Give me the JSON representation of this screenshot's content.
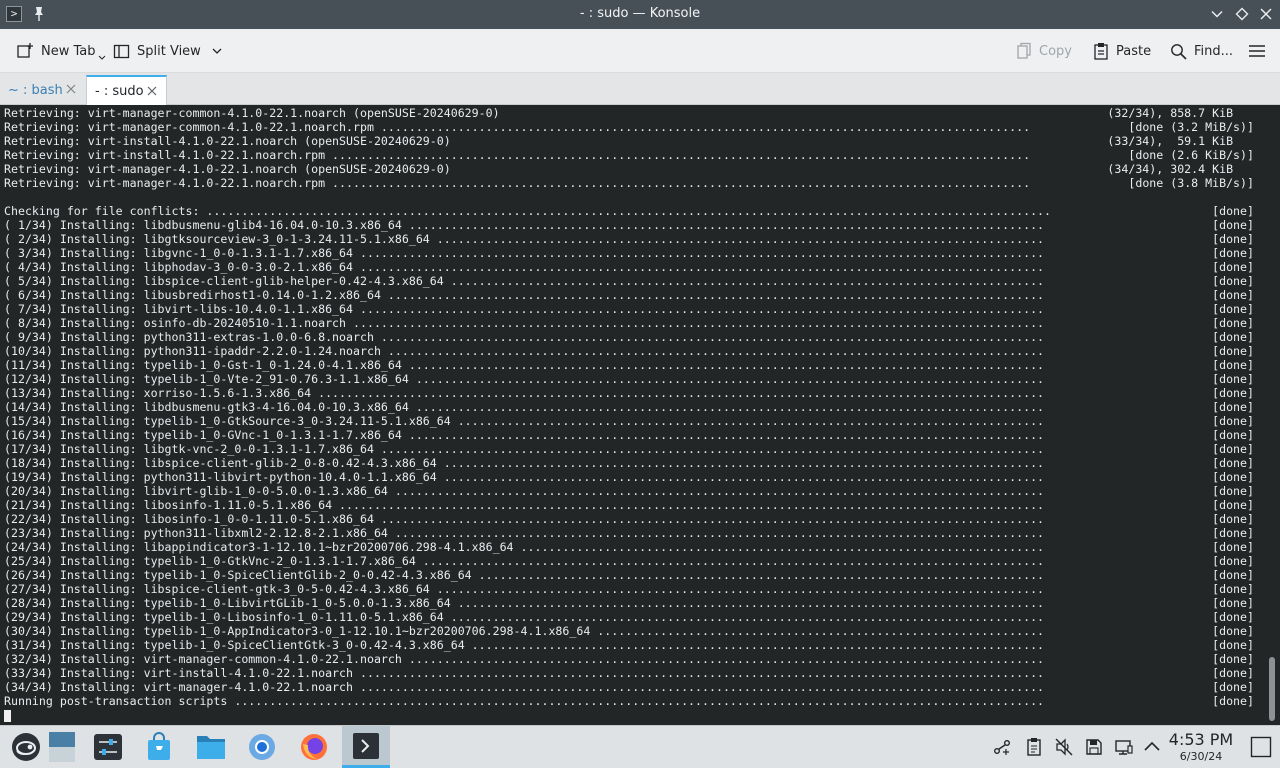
{
  "window": {
    "title": "- : sudo — Konsole"
  },
  "toolbar": {
    "new_tab_label": "New Tab",
    "split_view_label": "Split View",
    "copy_label": "Copy",
    "paste_label": "Paste",
    "find_label": "Find..."
  },
  "tabs": [
    {
      "label": "~ : bash",
      "active": false
    },
    {
      "label": "- : sudo",
      "active": true
    }
  ],
  "terminal": {
    "lines": [
      {
        "l": "Retrieving: virt-manager-common-4.1.0-22.1.noarch (openSUSE-20240629-0)",
        "r": "(32/34), 858.7 KiB   "
      },
      {
        "l": "Retrieving: virt-manager-common-4.1.0-22.1.noarch.rpm .............................................................................................",
        "r": "[done (3.2 MiB/s)]"
      },
      {
        "l": "Retrieving: virt-install-4.1.0-22.1.noarch (openSUSE-20240629-0)",
        "r": "(33/34),  59.1 KiB   "
      },
      {
        "l": "Retrieving: virt-install-4.1.0-22.1.noarch.rpm ....................................................................................................",
        "r": "[done (2.6 KiB/s)]"
      },
      {
        "l": "Retrieving: virt-manager-4.1.0-22.1.noarch (openSUSE-20240629-0)",
        "r": "(34/34), 302.4 KiB   "
      },
      {
        "l": "Retrieving: virt-manager-4.1.0-22.1.noarch.rpm ....................................................................................................",
        "r": "[done (3.8 MiB/s)]"
      },
      {
        "l": "",
        "r": ""
      },
      {
        "l": "Checking for file conflicts: .........................................................................................................................",
        "r": "[done]"
      },
      {
        "l": "( 1/34) Installing: libdbusmenu-glib4-16.04.0-10.3.x86_64 ...........................................................................................",
        "r": "[done]"
      },
      {
        "l": "( 2/34) Installing: libgtksourceview-3_0-1-3.24.11-5.1.x86_64 .......................................................................................",
        "r": "[done]"
      },
      {
        "l": "( 3/34) Installing: libgvnc-1_0-0-1.3.1-1.7.x86_64 ..................................................................................................",
        "r": "[done]"
      },
      {
        "l": "( 4/34) Installing: libphodav-3_0-0-3.0-2.1.x86_64 ..................................................................................................",
        "r": "[done]"
      },
      {
        "l": "( 5/34) Installing: libspice-client-glib-helper-0.42-4.3.x86_64 .....................................................................................",
        "r": "[done]"
      },
      {
        "l": "( 6/34) Installing: libusbredirhost1-0.14.0-1.2.x86_64 ..............................................................................................",
        "r": "[done]"
      },
      {
        "l": "( 7/34) Installing: libvirt-libs-10.4.0-1.1.x86_64 ..................................................................................................",
        "r": "[done]"
      },
      {
        "l": "( 8/34) Installing: osinfo-db-20240510-1.1.noarch ...................................................................................................",
        "r": "[done]"
      },
      {
        "l": "( 9/34) Installing: python311-extras-1.0.0-6.8.noarch ...............................................................................................",
        "r": "[done]"
      },
      {
        "l": "(10/34) Installing: python311-ipaddr-2.2.0-1.24.noarch ..............................................................................................",
        "r": "[done]"
      },
      {
        "l": "(11/34) Installing: typelib-1_0-Gst-1_0-1.24.0-4.1.x86_64 ...........................................................................................",
        "r": "[done]"
      },
      {
        "l": "(12/34) Installing: typelib-1_0-Vte-2_91-0.76.3-1.1.x86_64 ..........................................................................................",
        "r": "[done]"
      },
      {
        "l": "(13/34) Installing: xorriso-1.5.6-1.3.x86_64 ........................................................................................................",
        "r": "[done]"
      },
      {
        "l": "(14/34) Installing: libdbusmenu-gtk3-4-16.04.0-10.3.x86_64 ..........................................................................................",
        "r": "[done]"
      },
      {
        "l": "(15/34) Installing: typelib-1_0-GtkSource-3_0-3.24.11-5.1.x86_64 ....................................................................................",
        "r": "[done]"
      },
      {
        "l": "(16/34) Installing: typelib-1_0-GVnc-1_0-1.3.1-1.7.x86_64 ...........................................................................................",
        "r": "[done]"
      },
      {
        "l": "(17/34) Installing: libgtk-vnc-2_0-0-1.3.1-1.7.x86_64 ...............................................................................................",
        "r": "[done]"
      },
      {
        "l": "(18/34) Installing: libspice-client-glib-2_0-8-0.42-4.3.x86_64 ......................................................................................",
        "r": "[done]"
      },
      {
        "l": "(19/34) Installing: python311-libvirt-python-10.4.0-1.1.x86_64 ......................................................................................",
        "r": "[done]"
      },
      {
        "l": "(20/34) Installing: libvirt-glib-1_0-0-5.0.0-1.3.x86_64 .............................................................................................",
        "r": "[done]"
      },
      {
        "l": "(21/34) Installing: libosinfo-1.11.0-5.1.x86_64 .....................................................................................................",
        "r": "[done]"
      },
      {
        "l": "(22/34) Installing: libosinfo-1_0-0-1.11.0-5.1.x86_64 ...............................................................................................",
        "r": "[done]"
      },
      {
        "l": "(23/34) Installing: python311-libxml2-2.12.8-2.1.x86_64 .............................................................................................",
        "r": "[done]"
      },
      {
        "l": "(24/34) Installing: libappindicator3-1-12.10.1~bzr20200706.298-4.1.x86_64 ...........................................................................",
        "r": "[done]"
      },
      {
        "l": "(25/34) Installing: typelib-1_0-GtkVnc-2_0-1.3.1-1.7.x86_64 .........................................................................................",
        "r": "[done]"
      },
      {
        "l": "(26/34) Installing: typelib-1_0-SpiceClientGlib-2_0-0.42-4.3.x86_64 .................................................................................",
        "r": "[done]"
      },
      {
        "l": "(27/34) Installing: libspice-client-gtk-3_0-5-0.42-4.3.x86_64 .......................................................................................",
        "r": "[done]"
      },
      {
        "l": "(28/34) Installing: typelib-1_0-LibvirtGLib-1_0-5.0.0-1.3.x86_64 ....................................................................................",
        "r": "[done]"
      },
      {
        "l": "(29/34) Installing: typelib-1_0-Libosinfo-1_0-1.11.0-5.1.x86_64 .....................................................................................",
        "r": "[done]"
      },
      {
        "l": "(30/34) Installing: typelib-1_0-AppIndicator3-0_1-12.10.1~bzr20200706.298-4.1.x86_64 ................................................................",
        "r": "[done]"
      },
      {
        "l": "(31/34) Installing: typelib-1_0-SpiceClientGtk-3_0-0.42-4.3.x86_64 ..................................................................................",
        "r": "[done]"
      },
      {
        "l": "(32/34) Installing: virt-manager-common-4.1.0-22.1.noarch ...........................................................................................",
        "r": "[done]"
      },
      {
        "l": "(33/34) Installing: virt-install-4.1.0-22.1.noarch ..................................................................................................",
        "r": "[done]"
      },
      {
        "l": "(34/34) Installing: virt-manager-4.1.0-22.1.noarch ..................................................................................................",
        "r": "[done]"
      },
      {
        "l": "Running post-transaction scripts ....................................................................................................................",
        "r": "[done]"
      }
    ]
  },
  "taskbar": {
    "apps": [
      {
        "name": "application-launcher",
        "icon": "opensuse-icon"
      },
      {
        "name": "show-desktop",
        "icon": "desktop-icon"
      },
      {
        "name": "system-settings",
        "icon": "settings-icon"
      },
      {
        "name": "discover",
        "icon": "store-icon"
      },
      {
        "name": "dolphin",
        "icon": "folder-icon"
      },
      {
        "name": "chromium",
        "icon": "chromium-icon"
      },
      {
        "name": "firefox",
        "icon": "firefox-icon"
      },
      {
        "name": "konsole",
        "icon": "terminal-icon"
      }
    ],
    "clock": {
      "time": "4:53 PM",
      "date": "6/30/24"
    }
  },
  "colors": {
    "terminal_bg": "#232627",
    "terminal_fg": "#e8ecee",
    "titlebar_bg": "#475057",
    "accent": "#3daee9"
  }
}
